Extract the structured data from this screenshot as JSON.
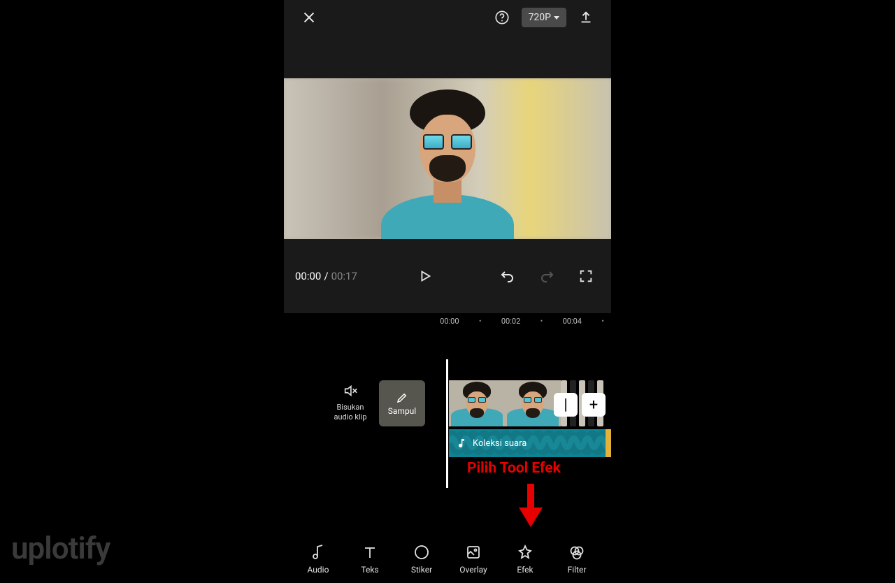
{
  "topbar": {
    "quality": "720P"
  },
  "player": {
    "current_time": "00:00",
    "separator": "/",
    "total_time": "00:17"
  },
  "ruler": {
    "t0": "00:00",
    "t1": "00:02",
    "t2": "00:04"
  },
  "timeline": {
    "mute_label_line1": "Bisukan",
    "mute_label_line2": "audio klip",
    "cover_label": "Sampul",
    "audio_label": "Koleksi suara",
    "transition_minus": "|",
    "transition_plus": "+"
  },
  "annotation": {
    "text": "Pilih Tool Efek"
  },
  "toolbar": {
    "audio": "Audio",
    "teks": "Teks",
    "stiker": "Stiker",
    "overlay": "Overlay",
    "efek": "Efek",
    "filter": "Filter"
  },
  "watermark": {
    "part1": "uplo",
    "part2": "tify"
  }
}
